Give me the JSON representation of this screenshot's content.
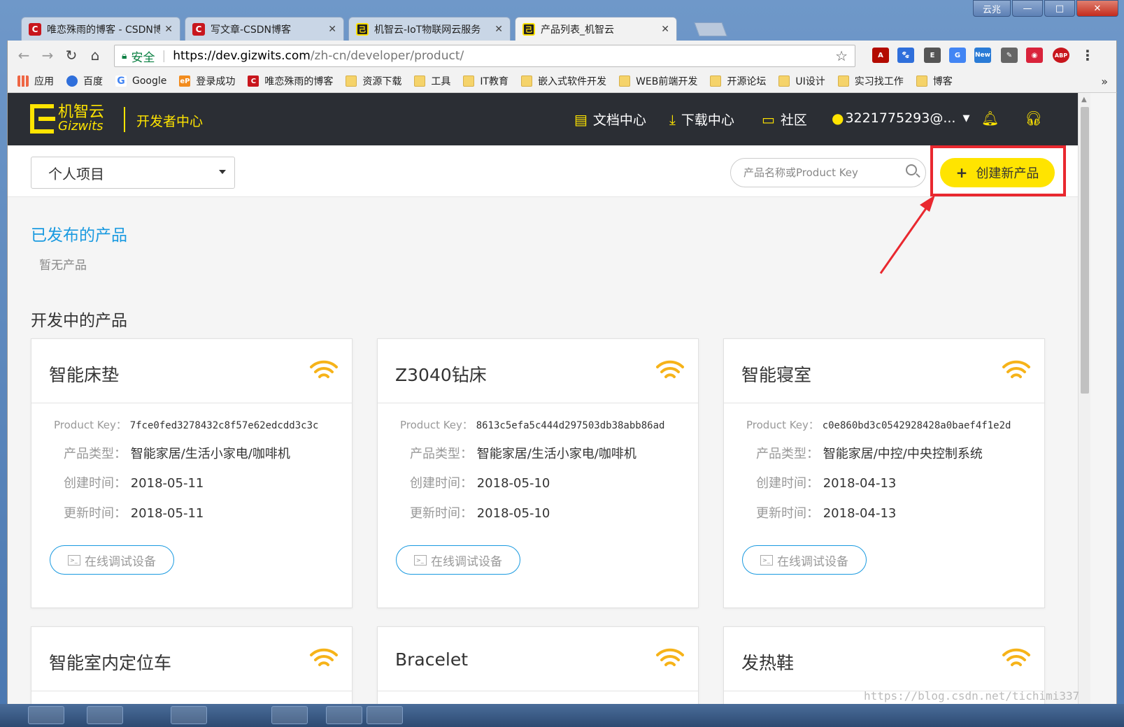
{
  "browser": {
    "tabs": [
      {
        "title": "唯恋殊雨的博客 - CSDN博",
        "favicon": "csdn-icon"
      },
      {
        "title": "写文章-CSDN博客",
        "favicon": "csdn-icon"
      },
      {
        "title": "机智云-IoT物联网云服务",
        "favicon": "gizwits-icon"
      },
      {
        "title": "产品列表_机智云",
        "favicon": "gizwits-icon",
        "active": true
      }
    ],
    "window_buttons": {
      "yun": "云兆",
      "min": "—",
      "max": "□",
      "close": "✕"
    },
    "secure_label": "安全",
    "url_host": "https://dev.gizwits.com",
    "url_path": "/zh-cn/developer/product/",
    "ext_new_label": "New",
    "ext_abp_label": "ABP",
    "bookmarks": [
      {
        "label": "应用",
        "icon": "apps-icon"
      },
      {
        "label": "百度",
        "icon": "baidu-paw-icon"
      },
      {
        "label": "Google",
        "icon": "google-icon"
      },
      {
        "label": "登录成功",
        "icon": "ep-icon"
      },
      {
        "label": "唯恋殊雨的博客",
        "icon": "csdn-icon"
      },
      {
        "label": "资源下载",
        "icon": "folder-icon"
      },
      {
        "label": "工具",
        "icon": "folder-icon"
      },
      {
        "label": "IT教育",
        "icon": "folder-icon"
      },
      {
        "label": "嵌入式软件开发",
        "icon": "folder-icon"
      },
      {
        "label": "WEB前端开发",
        "icon": "folder-icon"
      },
      {
        "label": "开源论坛",
        "icon": "folder-icon"
      },
      {
        "label": "UI设计",
        "icon": "folder-icon"
      },
      {
        "label": "实习找工作",
        "icon": "folder-icon"
      },
      {
        "label": "博客",
        "icon": "folder-icon"
      }
    ],
    "bookmarks_more": "»"
  },
  "header": {
    "logo_cn": "机智云",
    "logo_en": "Gizwits",
    "dev_center": "开发者中心",
    "nav": [
      {
        "label": "文档中心",
        "icon": "document-icon"
      },
      {
        "label": "下载中心",
        "icon": "download-icon"
      },
      {
        "label": "社区",
        "icon": "chat-icon"
      },
      {
        "label": "3221775293@...",
        "icon": "user-icon"
      }
    ]
  },
  "filter": {
    "project_select": "个人项目",
    "search_placeholder": "产品名称或Product Key",
    "create_button": "创建新产品",
    "create_plus": "+"
  },
  "published": {
    "title": "已发布的产品",
    "empty_text": "暂无产品"
  },
  "developing": {
    "title": "开发中的产品",
    "labels": {
      "product_key": "Product Key：",
      "type": "产品类型：",
      "created": "创建时间：",
      "updated": "更新时间：",
      "debug": "在线调试设备"
    },
    "products": [
      {
        "name": "智能床垫",
        "product_key": "7fce0fed3278432c8f57e62edcdd3c3c",
        "type": "智能家居/生活小家电/咖啡机",
        "created": "2018-05-11",
        "updated": "2018-05-11"
      },
      {
        "name": "Z3040钻床",
        "product_key": "8613c5efa5c444d297503db38abb86ad",
        "type": "智能家居/生活小家电/咖啡机",
        "created": "2018-05-10",
        "updated": "2018-05-10"
      },
      {
        "name": "智能寝室",
        "product_key": "c0e860bd3c0542928428a0baef4f1e2d",
        "type": "智能家居/中控/中央控制系统",
        "created": "2018-04-13",
        "updated": "2018-04-13"
      },
      {
        "name": "智能室内定位车"
      },
      {
        "name": "Bracelet"
      },
      {
        "name": "发热鞋"
      }
    ]
  },
  "watermark": "https://blog.csdn.net/tichimi337",
  "colors": {
    "accent_yellow": "#ffe400",
    "link_blue": "#1a9ae0",
    "highlight_red": "#e9282f",
    "header_dark": "#2b2e34"
  }
}
